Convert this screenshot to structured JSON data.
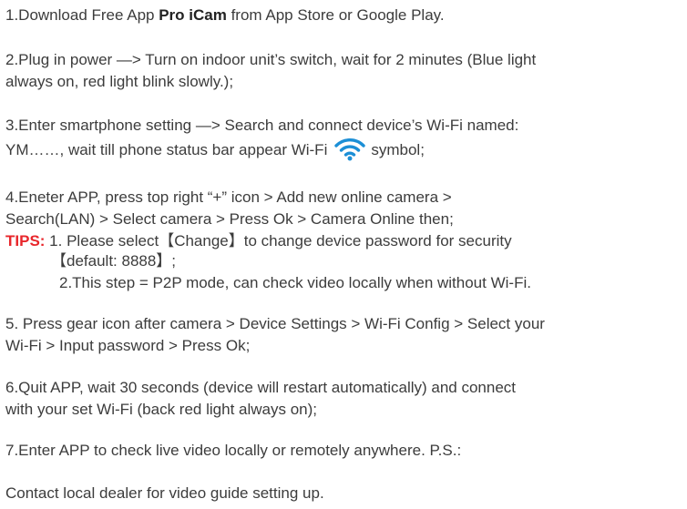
{
  "steps": {
    "s1": {
      "prefix": "1.Download Free App ",
      "brand": "Pro iCam",
      "suffix": " from App Store or Google Play."
    },
    "s2": {
      "line1": "2.Plug in power —> Turn on indoor unit’s switch, wait for 2 minutes (Blue light",
      "line2": "always on, red light blink slowly.);"
    },
    "s3": {
      "line1": "3.Enter smartphone setting —> Search and connect device’s Wi-Fi named:",
      "line2_before_icon": "YM……, wait till phone status bar appear Wi-Fi",
      "line2_after_icon": "symbol;"
    },
    "s4": {
      "line1": "4.Eneter APP, press top right “+” icon > Add new online camera >",
      "line2": "Search(LAN) > Select camera > Press Ok > Camera Online then;"
    },
    "tips": {
      "label": "TIPS:",
      "tip1_line1": " 1. Please select【Change】to change device password for security",
      "tip1_line2": "【default: 8888】;",
      "tip2": "2.This step = P2P mode, can check video locally when without Wi-Fi."
    },
    "s5": {
      "line1": "5. Press gear icon after camera > Device Settings > Wi-Fi Config > Select your",
      "line2": "Wi-Fi > Input password > Press Ok;"
    },
    "s6": {
      "line1": "6.Quit APP, wait 30 seconds (device will restart automatically) and connect",
      "line2": "with your set Wi-Fi (back red light always on);"
    },
    "s7": {
      "line1": "7.Enter APP to check live video locally or remotely anywhere. P.S.:"
    },
    "contact": "Contact local dealer for video guide setting up."
  },
  "icons": {
    "wifi": "wifi-icon"
  },
  "colors": {
    "text": "#3c3c3c",
    "tips": "#e8262b",
    "wifi": "#1c8fd6"
  }
}
